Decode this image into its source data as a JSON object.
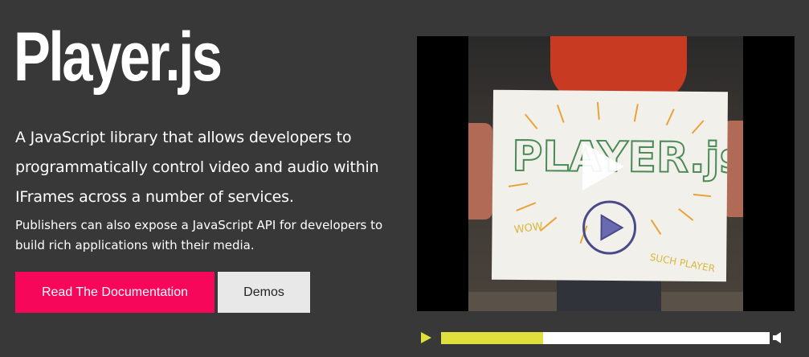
{
  "hero": {
    "title": "Player.js",
    "lead": "A JavaScript library that allows developers to programmatically control video and audio within IFrames across a number of services.",
    "sub": "Publishers can also expose a JavaScript API for developers to build rich applications with their media."
  },
  "buttons": {
    "primary_label": "Read The Documentation",
    "secondary_label": "Demos"
  },
  "colors": {
    "background": "#383838",
    "primary_button": "#f7075a",
    "secondary_button": "#e8e8e8",
    "progress_fill": "#e1df3e",
    "play_icon": "#e1df3e"
  },
  "video": {
    "poster_text": "PLAYER.js",
    "doodle_left": "WOW",
    "doodle_right": "SUCH PLAYER"
  },
  "player": {
    "progress_fraction": 0.31,
    "icons": {
      "play": "play-icon",
      "volume": "volume-icon",
      "overlay": "play-overlay-icon"
    }
  }
}
